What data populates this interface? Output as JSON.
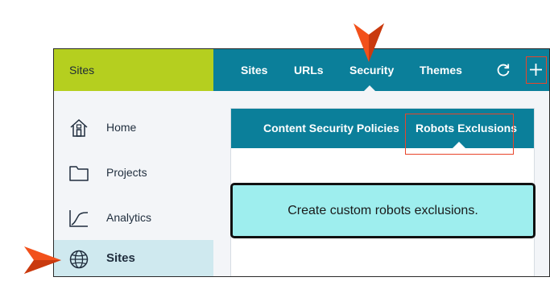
{
  "header": {
    "brand_title": "Sites",
    "nav": [
      {
        "label": "Sites",
        "active": false
      },
      {
        "label": "URLs",
        "active": false
      },
      {
        "label": "Security",
        "active": true
      },
      {
        "label": "Themes",
        "active": false
      }
    ],
    "refresh_icon": "refresh-icon",
    "add_icon": "plus-icon"
  },
  "sidebar": {
    "items": [
      {
        "label": "Home",
        "icon": "home-icon",
        "active": false
      },
      {
        "label": "Projects",
        "icon": "folder-icon",
        "active": false
      },
      {
        "label": "Analytics",
        "icon": "analytics-icon",
        "active": false
      },
      {
        "label": "Sites",
        "icon": "globe-icon",
        "active": true
      }
    ]
  },
  "panel": {
    "tabs": [
      {
        "label": "Content Security Policies",
        "active": false
      },
      {
        "label": "Robots Exclusions",
        "active": true
      }
    ]
  },
  "callout": {
    "text": "Create custom robots exclusions."
  },
  "colors": {
    "brand": "#b5cf1f",
    "nav": "#0b7f9a",
    "highlight": "#e8452a",
    "active_sidebar": "#cfe9ef",
    "callout_bg": "#9eeeee",
    "pointer": "#f2511b"
  }
}
